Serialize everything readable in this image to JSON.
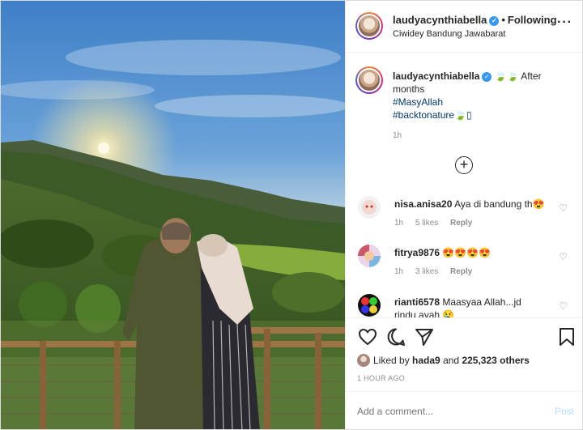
{
  "post": {
    "username": "laudyacynthiabella",
    "follow_status": "Following",
    "location": "Ciwidey Bandung Jawabarat",
    "more_icon": "ellipsis-icon"
  },
  "caption": {
    "username": "laudyacynthiabella",
    "text_a": "After",
    "text_b": "months",
    "hashtag_1": "#MasyAllah",
    "hashtag_2": "#backtonature",
    "time": "1h"
  },
  "comments": [
    {
      "username": "nisa.anisa20",
      "text": "Aya di bandung th",
      "time": "1h",
      "likes": "5 likes",
      "reply": "Reply"
    },
    {
      "username": "fitrya9876",
      "text": "",
      "time": "1h",
      "likes": "3 likes",
      "reply": "Reply"
    },
    {
      "username": "rianti6578",
      "text": "Maasyaa Allah...jd",
      "text_more": "rindu ayah",
      "time": "",
      "likes": "",
      "reply": ""
    }
  ],
  "actions": {
    "liked_by_prefix": "Liked by",
    "liked_by_user": "hada9",
    "liked_by_and": "and",
    "liked_by_count": "225,323 others",
    "timestamp": "1 HOUR AGO"
  },
  "composer": {
    "placeholder": "Add a comment...",
    "post_label": "Post"
  },
  "colors": {
    "link": "#00376b",
    "verified": "#3897f0",
    "post_disabled": "#b2dffc",
    "meta_gray": "#8e8e8e"
  }
}
